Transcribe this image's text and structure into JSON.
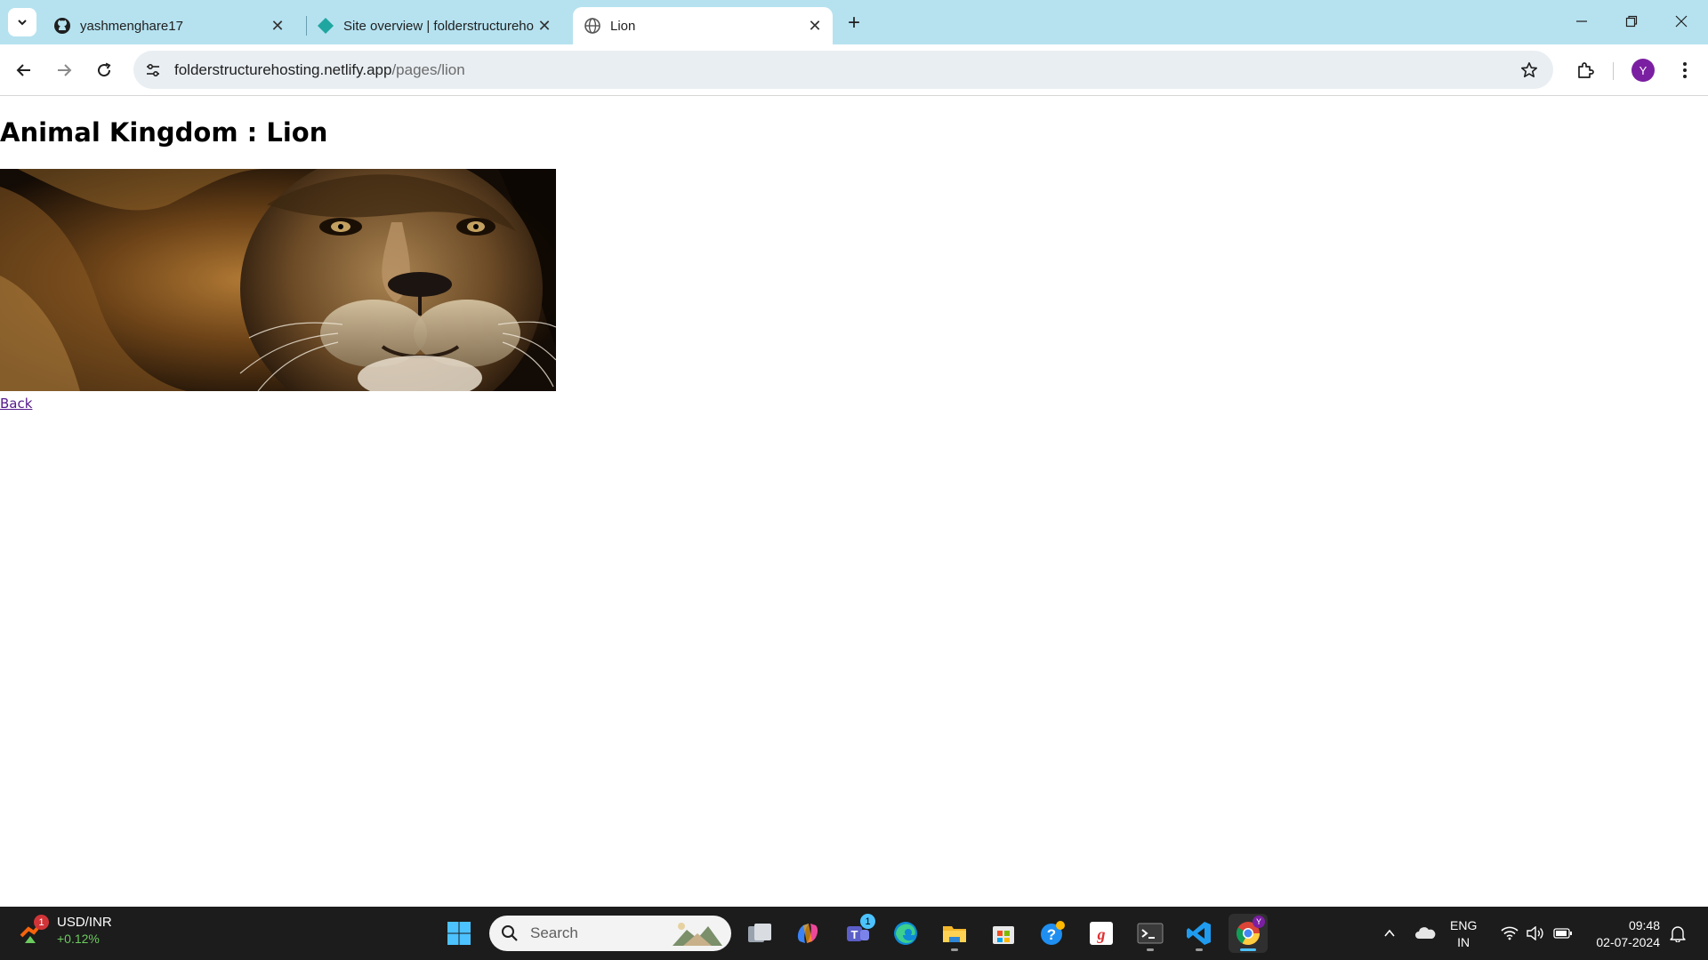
{
  "browser": {
    "tabs": [
      {
        "title": "yashmenghare17",
        "icon": "github-icon"
      },
      {
        "title": "Site overview | folderstructurehosting",
        "icon": "netlify-icon"
      },
      {
        "title": "Lion",
        "icon": "globe-icon"
      }
    ],
    "url_host": "folderstructurehosting.netlify.app",
    "url_path": "/pages/lion",
    "profile_initial": "Y"
  },
  "page": {
    "heading": "Animal Kingdom : Lion",
    "image_alt": "Lion",
    "back_link": "Back"
  },
  "taskbar": {
    "widget": {
      "title": "USD/INR",
      "change": "+0.12%",
      "badge": "1"
    },
    "search_placeholder": "Search",
    "teams_badge": "1",
    "language_line1": "ENG",
    "language_line2": "IN",
    "time": "09:48",
    "date": "02-07-2024"
  },
  "colors": {
    "tabstrip": "#b6e2f0",
    "link_visited": "#551a8b",
    "taskbar": "#1c1c1c",
    "profile": "#7b1fa2"
  }
}
